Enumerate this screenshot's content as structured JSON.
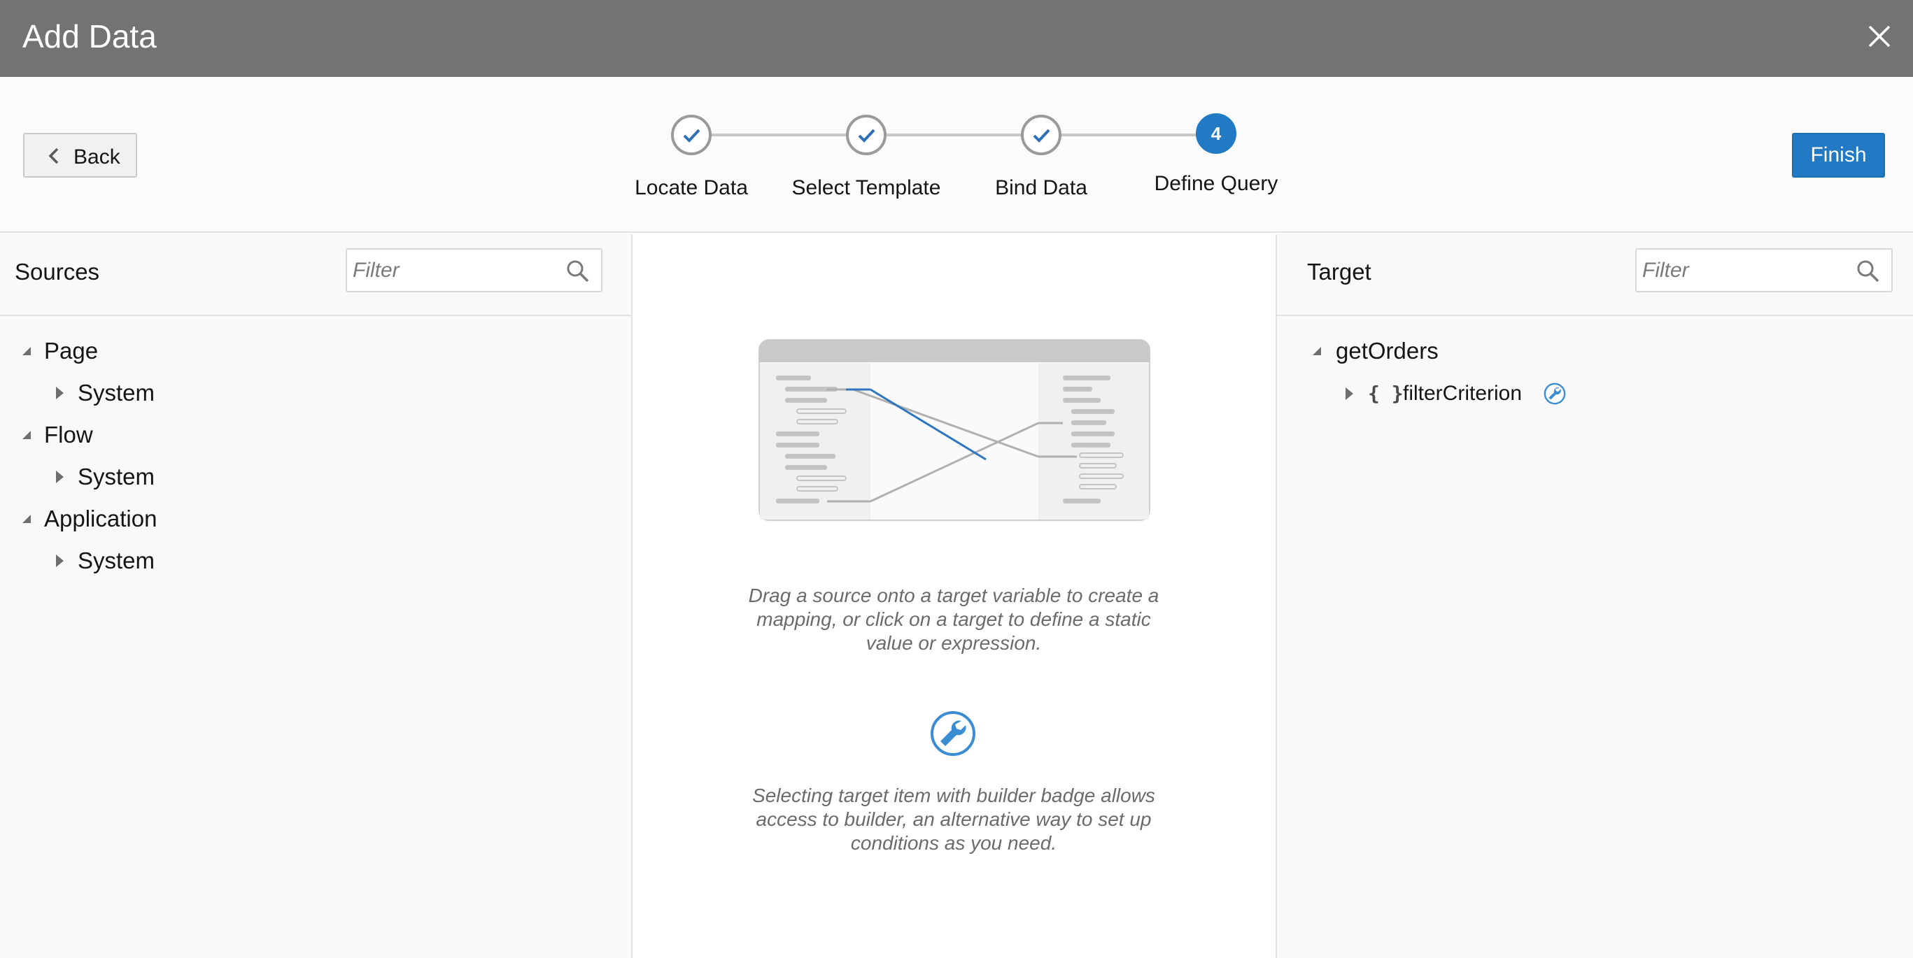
{
  "dialog": {
    "title": "Add Data",
    "close_icon": "close-icon"
  },
  "toolbar": {
    "back_label": "Back",
    "finish_label": "Finish"
  },
  "train": {
    "steps": [
      {
        "label": "Locate Data",
        "state": "completed"
      },
      {
        "label": "Select Template",
        "state": "completed"
      },
      {
        "label": "Bind Data",
        "state": "completed"
      },
      {
        "label": "Define Query",
        "state": "current",
        "number": "4"
      }
    ]
  },
  "sources": {
    "title": "Sources",
    "filter_placeholder": "Filter",
    "tree": [
      {
        "label": "Page",
        "expanded": true,
        "children": [
          {
            "label": "System",
            "expanded": false
          }
        ]
      },
      {
        "label": "Flow",
        "expanded": true,
        "children": [
          {
            "label": "System",
            "expanded": false
          }
        ]
      },
      {
        "label": "Application",
        "expanded": true,
        "children": [
          {
            "label": "System",
            "expanded": false
          }
        ]
      }
    ]
  },
  "center": {
    "hint_mapping": "Drag a source onto a target variable to create a mapping, or click on a target to define a static value or expression.",
    "hint_builder": "Selecting target item with builder badge allows access to builder, an alternative way to set up conditions as you need."
  },
  "target": {
    "title": "Target",
    "filter_placeholder": "Filter",
    "tree": [
      {
        "label": "getOrders",
        "expanded": true,
        "children": [
          {
            "label": "filterCriterion",
            "type_glyph": "{ }",
            "expanded": false,
            "badge": "builder-badge-icon"
          }
        ]
      }
    ]
  },
  "colors": {
    "titlebar": "#737373",
    "accent": "#227ac4",
    "check": "#2f6fb5",
    "builder_badge": "#3a8dd2"
  }
}
